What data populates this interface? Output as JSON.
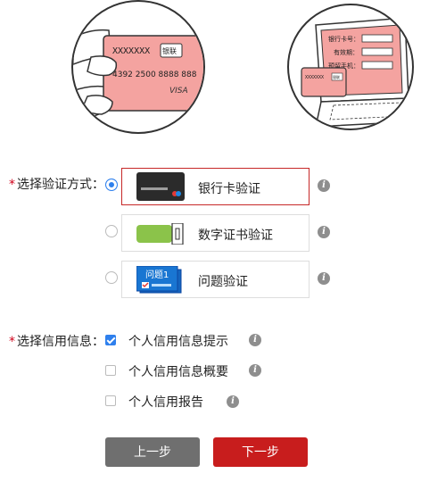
{
  "illustrations": {
    "card": {
      "number_masked": "XXXXXXX",
      "brand": "银联",
      "card_number": "4392 2500 8888 888",
      "network": "VISA"
    },
    "laptop": {
      "fields": [
        {
          "label": "银行卡号："
        },
        {
          "label": "有效期："
        },
        {
          "label": "预留手机："
        }
      ],
      "card_number_masked": "XXXXXXX",
      "card_brand": "银联"
    }
  },
  "verify": {
    "label": "选择验证方式：",
    "options": [
      {
        "label": "银行卡验证",
        "selected": true
      },
      {
        "label": "数字证书验证",
        "selected": false
      },
      {
        "label": "问题验证",
        "selected": false,
        "icon_text": "问题1"
      }
    ]
  },
  "credit": {
    "label": "选择信用信息：",
    "items": [
      {
        "label": "个人信用信息提示",
        "checked": true
      },
      {
        "label": "个人信用信息概要",
        "checked": false
      },
      {
        "label": "个人信用报告",
        "checked": false
      }
    ]
  },
  "buttons": {
    "prev": "上一步",
    "next": "下一步"
  },
  "colors": {
    "accent_red": "#c81d1d",
    "accent_blue": "#2f80ed",
    "card_pink": "#f4a3a0",
    "usb_green": "#8bc34a",
    "info_gray": "#8e8e8e"
  },
  "icons": {
    "info": "info-icon",
    "card": "bank-card-icon",
    "usb_key": "usb-key-icon",
    "question": "question-icon"
  }
}
